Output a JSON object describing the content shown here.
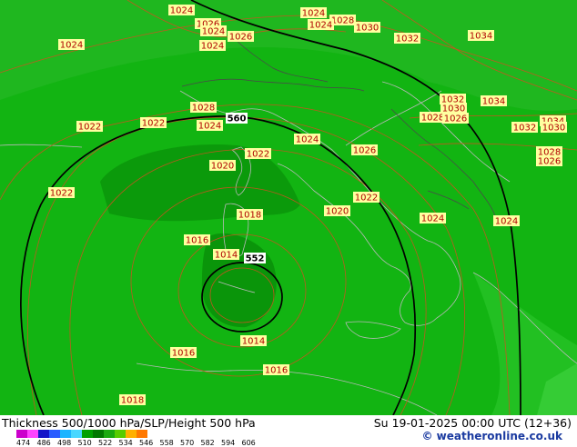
{
  "map": {
    "isobar_labels": [
      "1024",
      "1024",
      "1026",
      "1024",
      "1028",
      "1024",
      "1030",
      "1032",
      "1034",
      "1024",
      "1026",
      "1024",
      "1032",
      "1034",
      "1030",
      "1028",
      "1026",
      "1034",
      "1030",
      "1032",
      "1022",
      "1022",
      "1028",
      "1024",
      "1024",
      "1026",
      "1028",
      "1026",
      "1022",
      "1020",
      "1022",
      "1022",
      "1020",
      "1024",
      "1024",
      "1018",
      "1016",
      "1014",
      "1014",
      "1016",
      "1016",
      "1018"
    ],
    "height_labels": [
      "560",
      "552"
    ]
  },
  "footer": {
    "title": "Thickness 500/1000 hPa/SLP/Height 500 hPa",
    "datetime": "Su 19-01-2025 00:00 UTC (12+36)",
    "credit": "© weatheronline.co.uk",
    "legend_ticks": [
      "474",
      "486",
      "498",
      "510",
      "522",
      "534",
      "546",
      "558",
      "570",
      "582",
      "594",
      "606"
    ],
    "legend_colors": [
      "#cc00cc",
      "#ff44ff",
      "#1414c8",
      "#2a5cff",
      "#1cb4ff",
      "#49d7ff",
      "#00a000",
      "#007800",
      "#1aaa10",
      "#58cc00",
      "#ffb000",
      "#ff7800"
    ]
  }
}
